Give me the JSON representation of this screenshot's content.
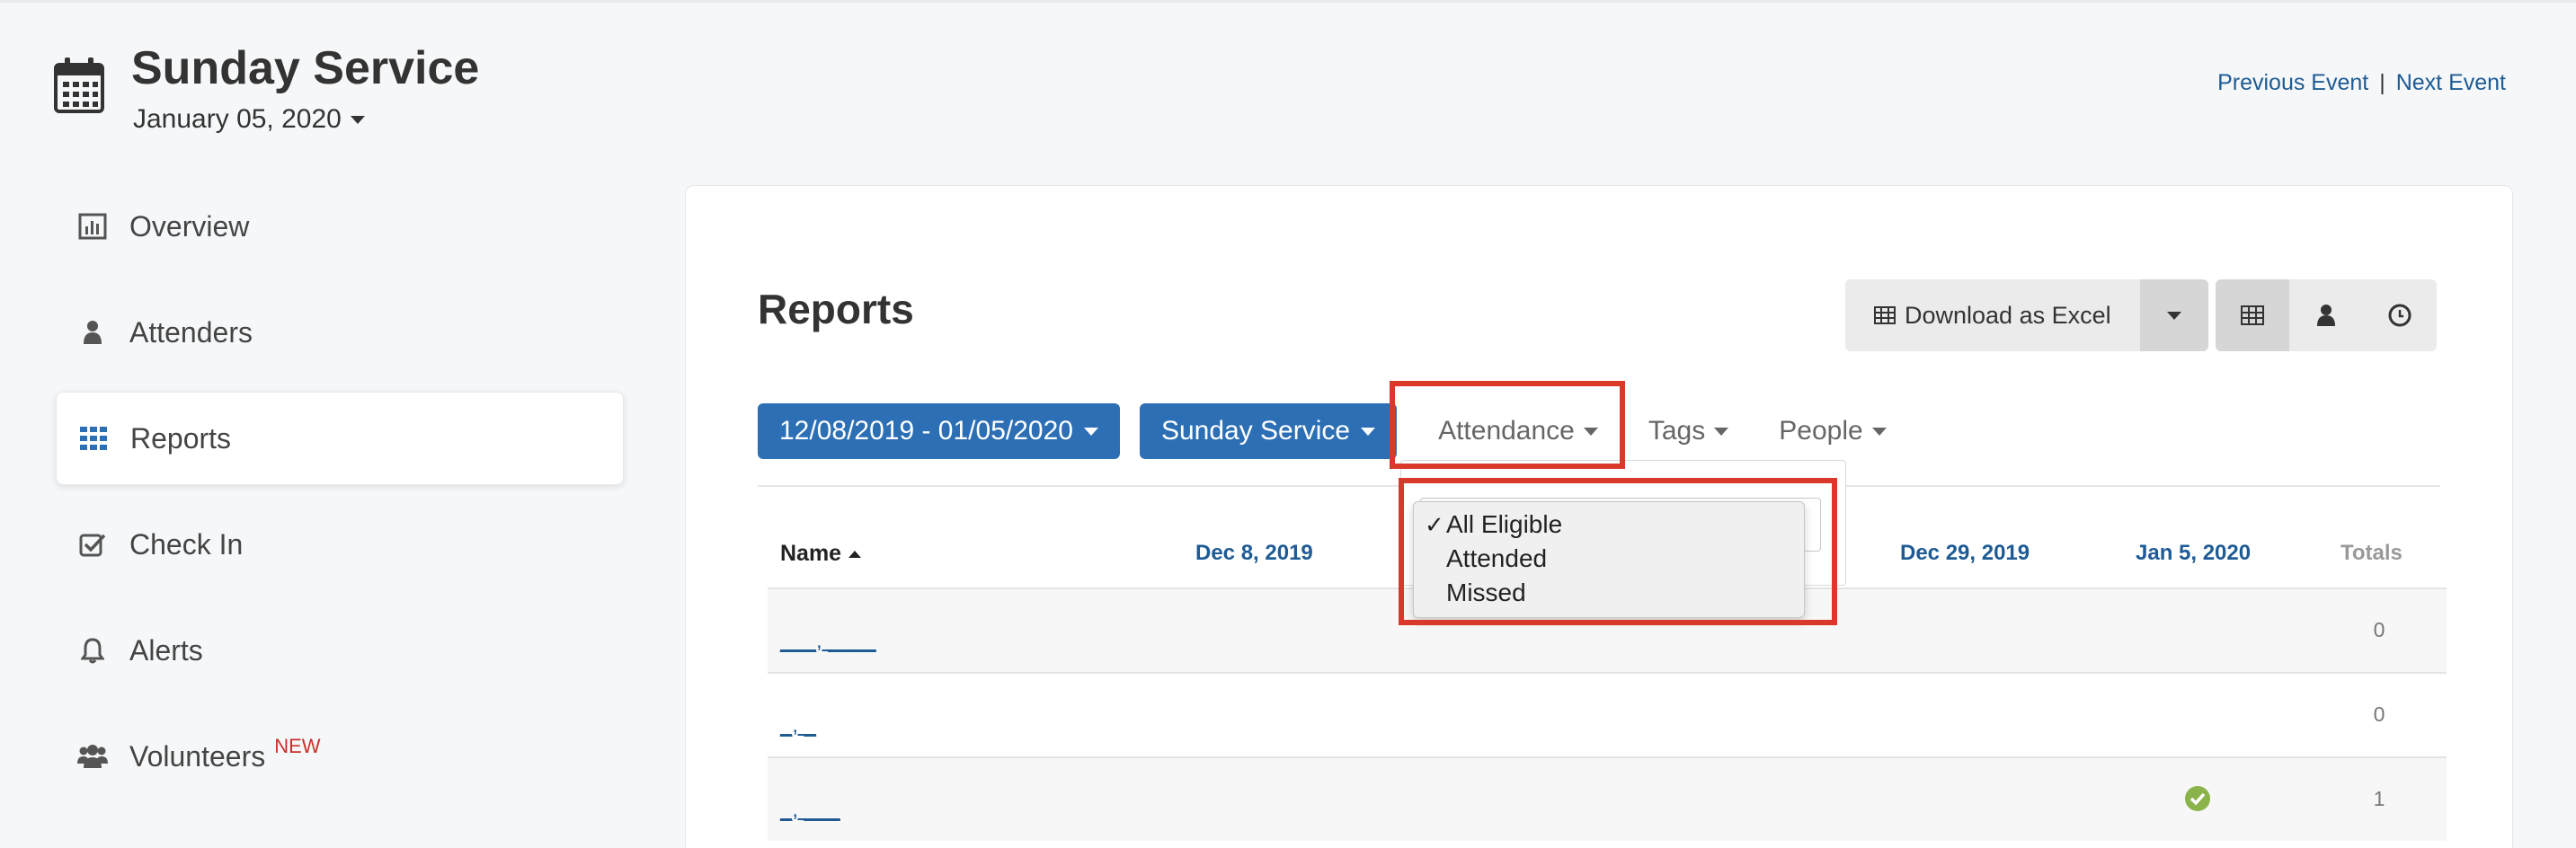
{
  "header": {
    "title": "Sunday Service",
    "date": "January 05, 2020",
    "previous_event": "Previous Event",
    "separator": "|",
    "next_event": "Next Event"
  },
  "sidebar": {
    "items": [
      {
        "label": "Overview",
        "icon": "bar-chart-icon"
      },
      {
        "label": "Attenders",
        "icon": "person-icon"
      },
      {
        "label": "Reports",
        "icon": "grid-icon",
        "active": true
      },
      {
        "label": "Check In",
        "icon": "checkbox-icon"
      },
      {
        "label": "Alerts",
        "icon": "bell-icon"
      },
      {
        "label": "Volunteers",
        "icon": "group-icon",
        "badge": "NEW"
      }
    ]
  },
  "main": {
    "title": "Reports",
    "download_label": "Download as Excel",
    "view_buttons": [
      "table-view-icon",
      "person-view-icon",
      "clock-view-icon"
    ],
    "filters": {
      "date_range": "12/08/2019 - 01/05/2020",
      "event": "Sunday Service",
      "attendance": "Attendance",
      "tags": "Tags",
      "people": "People"
    },
    "attendance_dropdown": {
      "options": [
        {
          "label": "All Eligible",
          "selected": true
        },
        {
          "label": "Attended",
          "selected": false
        },
        {
          "label": "Missed",
          "selected": false
        }
      ],
      "check_mark": "✓"
    },
    "table": {
      "columns": {
        "name": "Name",
        "dec8": "Dec 8, 2019",
        "dec29": "Dec 29, 2019",
        "jan5": "Jan 5, 2020",
        "totals": "Totals"
      },
      "rows": [
        {
          "name": "___, ____",
          "total": "0",
          "jan5_attended": false
        },
        {
          "name": "_, _",
          "total": "0",
          "jan5_attended": false
        },
        {
          "name": "_, ___",
          "total": "1",
          "jan5_attended": true
        }
      ]
    }
  },
  "colors": {
    "accent_blue": "#2c6fb5",
    "link_blue": "#1e5b94",
    "highlight_red": "#d8392b",
    "check_green": "#8ab34a",
    "badge_red": "#c9302c"
  }
}
